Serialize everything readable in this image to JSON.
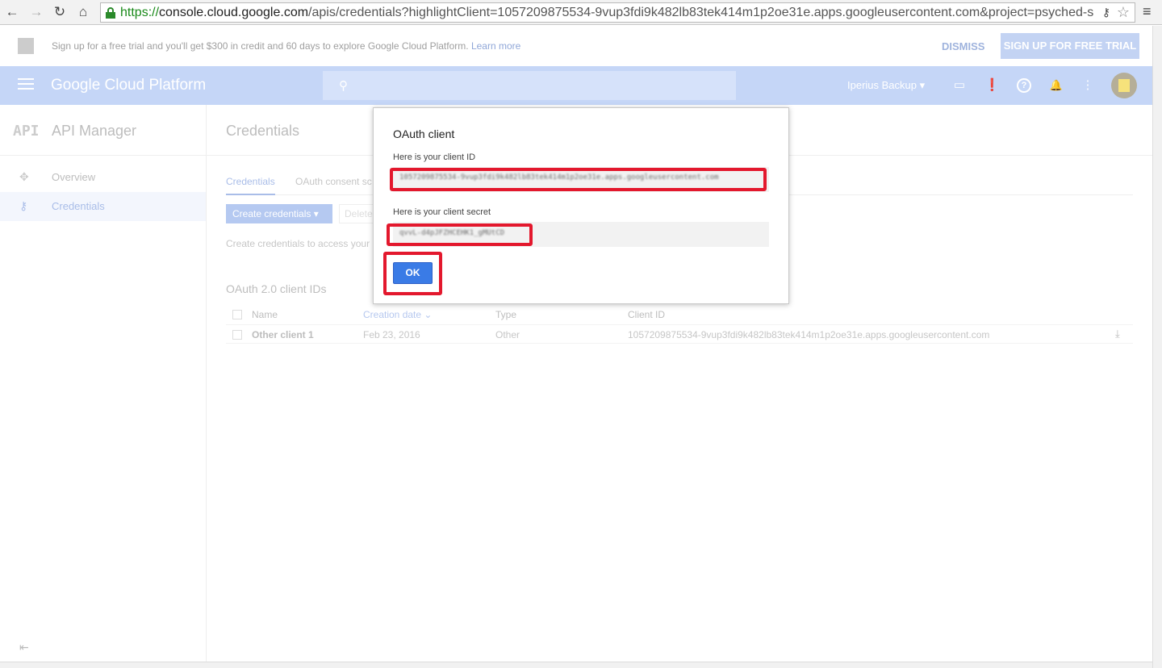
{
  "browser": {
    "url_scheme": "https://",
    "url_host": "console.cloud.google.com",
    "url_rest": "/apis/credentials?highlightClient=1057209875534-9vup3fdi9k482lb83tek414m1p2oe31e.apps.googleusercontent.com&project=psyched-s",
    "back_icon": "←",
    "forward_icon": "→",
    "reload_icon": "↻",
    "home_icon": "⌂",
    "key_icon": "⚷",
    "star_icon": "☆",
    "menu_icon": "≡"
  },
  "trial_banner": {
    "text": "Sign up for a free trial and you'll get $300 in credit and 60 days to explore Google Cloud Platform.",
    "learn_more": "Learn more",
    "dismiss": "DISMISS",
    "signup": "SIGN UP FOR FREE TRIAL"
  },
  "header": {
    "brand": "Google Cloud Platform",
    "search_icon": "⚲",
    "project": "Iperius Backup",
    "project_caret": "▾",
    "icons": {
      "console": "▭",
      "feedback": "❗",
      "help": "?",
      "notifications": "🔔",
      "more": "⋮"
    }
  },
  "sidebar": {
    "logo": "API",
    "title": "API Manager",
    "items": [
      {
        "label": "Overview",
        "icon": "✥"
      },
      {
        "label": "Credentials",
        "icon": "⚷"
      }
    ],
    "collapse_icon": "⇤"
  },
  "main": {
    "title": "Credentials",
    "tabs": [
      "Credentials",
      "OAuth consent sc"
    ],
    "create_button": "Create credentials",
    "create_caret": "▾",
    "delete_button": "Delete",
    "hint": "Create credentials to access your",
    "section_title": "OAuth 2.0 client IDs",
    "columns": [
      "Name",
      "Creation date",
      "Type",
      "Client ID"
    ],
    "sort_icon": "⌄",
    "rows": [
      {
        "name": "Other client 1",
        "creation_date": "Feb 23, 2016",
        "type": "Other",
        "client_id": "1057209875534-9vup3fdi9k482lb83tek414m1p2oe31e.apps.googleusercontent.com"
      }
    ],
    "download_icon": "⤓"
  },
  "dialog": {
    "title": "OAuth client",
    "client_id_label": "Here is your client ID",
    "client_id_value": "1057209875534-9vup3fdi9k482lb83tek414m1p2oe31e.apps.googleusercontent.com",
    "client_secret_label": "Here is your client secret",
    "client_secret_value": "qvvL-d4pJFZHCEHK1_gMUtCD",
    "ok_button": "OK",
    "highlight_color": "#e3182d"
  }
}
